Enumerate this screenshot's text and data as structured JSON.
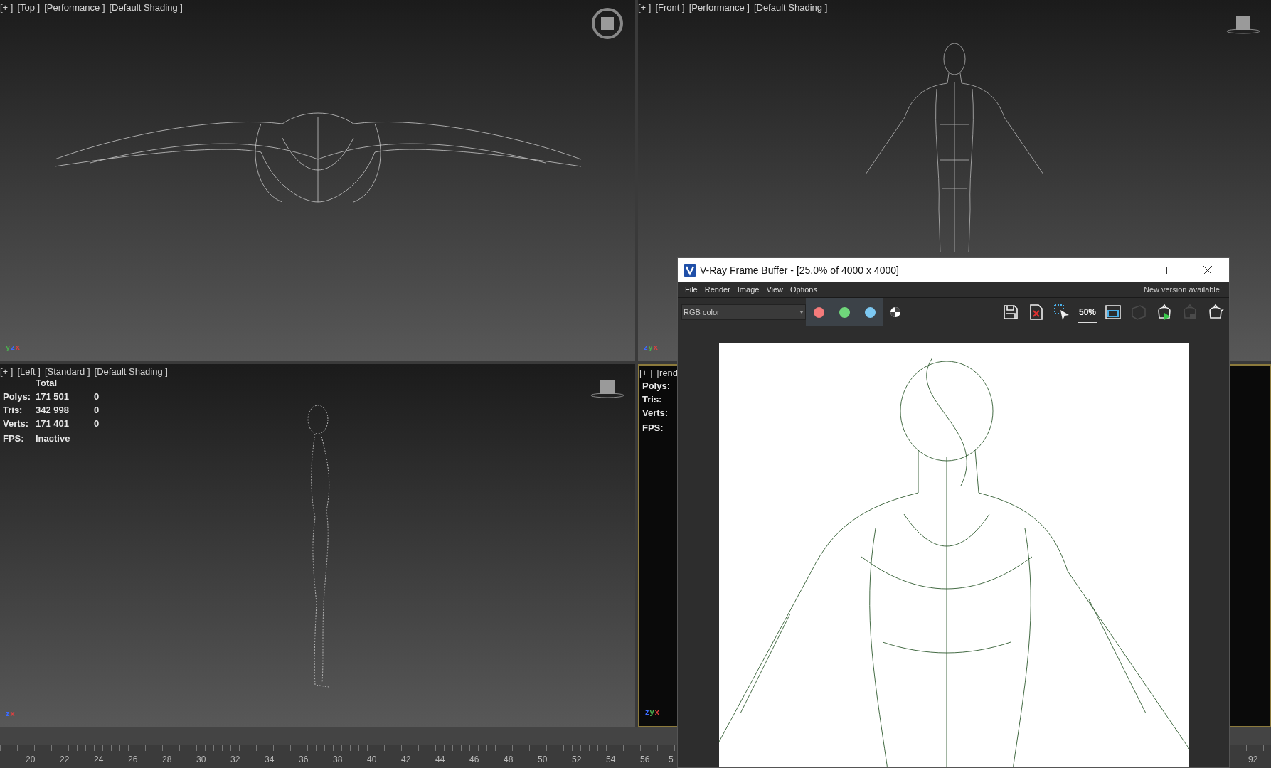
{
  "viewports": [
    {
      "kind": "top",
      "active": false,
      "labels": [
        "[+ ]",
        "[Top ]",
        "[Performance ]",
        "[Default Shading ]"
      ],
      "axes": [
        {
          "label": "y",
          "color": "#4caf50"
        },
        {
          "label": "z",
          "color": "#3b6bff"
        },
        {
          "label": "x",
          "color": "#e04040"
        }
      ]
    },
    {
      "kind": "front",
      "active": false,
      "labels": [
        "[+ ]",
        "[Front ]",
        "[Performance ]",
        "[Default Shading ]"
      ],
      "axes": [
        {
          "label": "z",
          "color": "#3b6bff"
        },
        {
          "label": "y",
          "color": "#4caf50"
        },
        {
          "label": "x",
          "color": "#e04040"
        }
      ]
    },
    {
      "kind": "left",
      "active": false,
      "labels": [
        "[+ ]",
        "[Left ]",
        "[Standard ]",
        "[Default Shading ]"
      ],
      "stats": {
        "header": "Total",
        "rows": [
          {
            "label": "Polys:",
            "total": "171 501",
            "selected": "0"
          },
          {
            "label": "Tris:",
            "total": "342 998",
            "selected": "0"
          },
          {
            "label": "Verts:",
            "total": "171 401",
            "selected": "0"
          }
        ],
        "fps_label": "FPS:",
        "fps": "Inactive"
      },
      "axes": [
        {
          "label": "z",
          "color": "#3b6bff"
        },
        {
          "label": "x",
          "color": "#e04040"
        }
      ]
    },
    {
      "kind": "render",
      "active": true,
      "labels": [
        "[+ ]",
        "[rend"
      ],
      "stats": {
        "rows": [
          {
            "label": "Polys:"
          },
          {
            "label": "Tris:"
          },
          {
            "label": "Verts:"
          }
        ],
        "fps_label": "FPS:"
      },
      "axes": [
        {
          "label": "z",
          "color": "#3b6bff"
        },
        {
          "label": "y",
          "color": "#4caf50"
        },
        {
          "label": "x",
          "color": "#e04040"
        }
      ]
    }
  ],
  "ruler": {
    "labels": [
      "20",
      "22",
      "24",
      "26",
      "28",
      "30",
      "32",
      "34",
      "36",
      "38",
      "40",
      "42",
      "44",
      "46",
      "48",
      "50",
      "52",
      "54",
      "56",
      "5"
    ],
    "right_label": "92"
  },
  "frame_buffer": {
    "title": "V-Ray Frame Buffer - [25.0% of 4000 x 4000]",
    "menu": [
      "File",
      "Render",
      "Image",
      "View",
      "Options"
    ],
    "notice": "New version available!",
    "channel_select": "RGB color",
    "channels": [
      {
        "color": "#f47b7b",
        "selected": true
      },
      {
        "color": "#6fd67a",
        "selected": true
      },
      {
        "color": "#7cc8f2",
        "selected": true
      }
    ],
    "tools": [
      {
        "kind": "save",
        "disabled": false
      },
      {
        "kind": "clear",
        "disabled": false
      },
      {
        "kind": "region",
        "disabled": false
      },
      {
        "kind": "zoom",
        "label": "50%",
        "disabled": false
      },
      {
        "kind": "frame",
        "disabled": false
      },
      {
        "kind": "region-render",
        "disabled": true
      },
      {
        "kind": "render",
        "disabled": false
      },
      {
        "kind": "render-interactive",
        "disabled": true
      },
      {
        "kind": "teapot",
        "disabled": false
      }
    ]
  }
}
